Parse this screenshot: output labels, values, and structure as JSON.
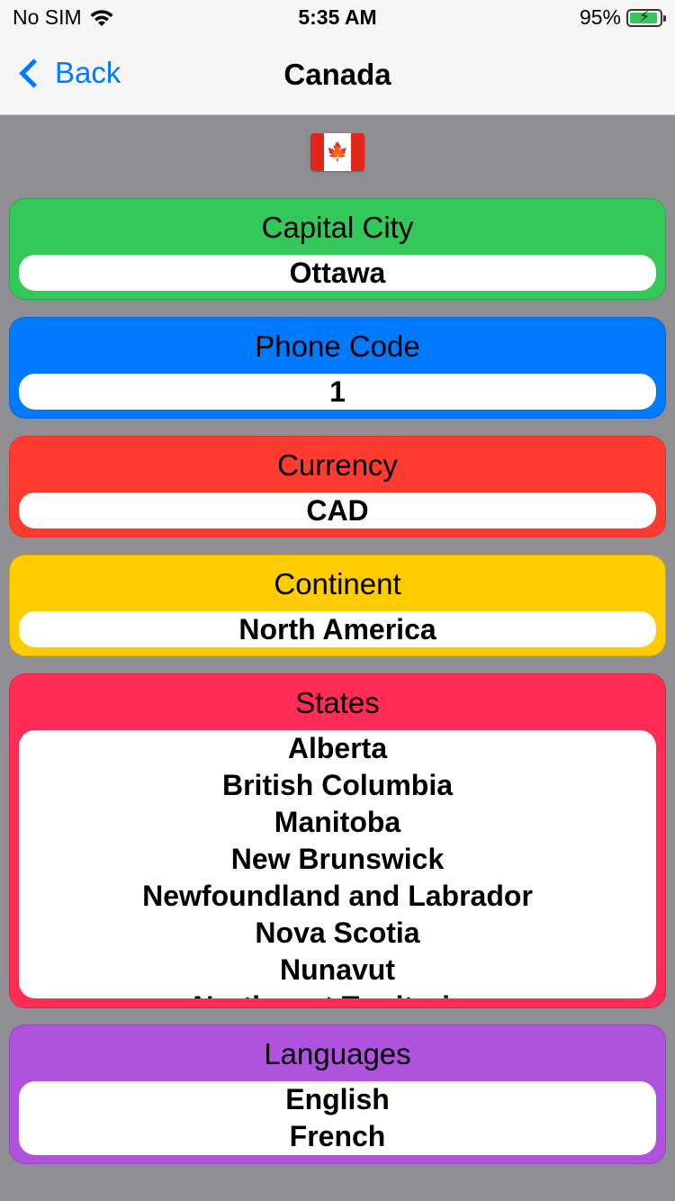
{
  "status_bar": {
    "carrier": "No SIM",
    "time": "5:35 AM",
    "battery_percent": "95%",
    "battery_level": 0.95
  },
  "nav": {
    "back_label": "Back",
    "title": "Canada"
  },
  "flag": {
    "icon": "canada-flag-icon",
    "symbol": "🍁"
  },
  "colors": {
    "capital": "#34c759",
    "phone": "#007aff",
    "currency": "#ff3b30",
    "continent": "#ffcc00",
    "states": "#ff2d55",
    "languages": "#af52de",
    "background": "#8e8e93",
    "accent": "#007aff"
  },
  "capital": {
    "title": "Capital City",
    "value": "Ottawa"
  },
  "phone": {
    "title": "Phone Code",
    "value": "1"
  },
  "currency": {
    "title": "Currency",
    "value": "CAD"
  },
  "continent": {
    "title": "Continent",
    "value": "North America"
  },
  "states": {
    "title": "States",
    "items": [
      "Alberta",
      "British Columbia",
      "Manitoba",
      "New Brunswick",
      "Newfoundland and Labrador",
      "Nova Scotia",
      "Nunavut",
      "Northwest Territories"
    ]
  },
  "languages": {
    "title": "Languages",
    "items": [
      "English",
      "French"
    ]
  }
}
